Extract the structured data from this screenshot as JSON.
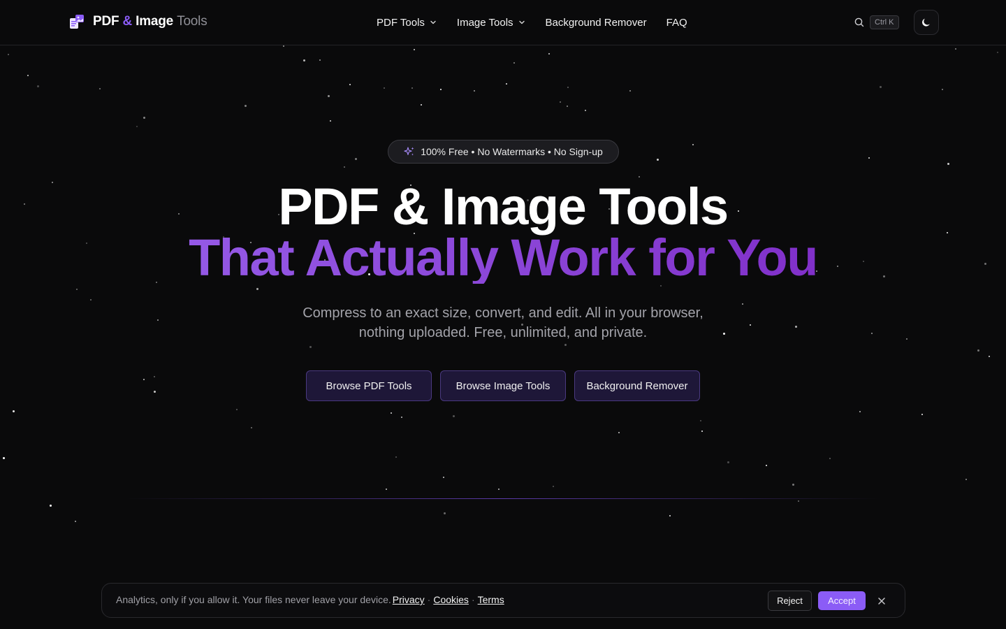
{
  "header": {
    "logo": {
      "part1": "PDF",
      "amp": "&",
      "part2": "Image",
      "part3": "Tools",
      "icon": "pdf-image-logo-icon"
    },
    "nav": [
      {
        "label": "PDF Tools",
        "has_dropdown": true
      },
      {
        "label": "Image Tools",
        "has_dropdown": true
      },
      {
        "label": "Background Remover",
        "has_dropdown": false
      },
      {
        "label": "FAQ",
        "has_dropdown": false
      }
    ],
    "search": {
      "icon": "search-icon",
      "shortcut": "Ctrl K"
    },
    "theme_toggle": {
      "icon": "moon-icon"
    }
  },
  "hero": {
    "badge": {
      "icon": "sparkles-icon",
      "text": "100% Free • No Watermarks • No Sign-up"
    },
    "title_line1": "PDF & Image Tools",
    "title_line2": "That Actually Work for You",
    "subtitle_line1": "Compress to an exact size, convert, and edit. All in your browser,",
    "subtitle_line2": "nothing uploaded. Free, unlimited, and private.",
    "buttons": [
      {
        "label": "Browse PDF Tools"
      },
      {
        "label": "Browse Image Tools"
      },
      {
        "label": "Background Remover"
      }
    ]
  },
  "cookie_bar": {
    "text": "Analytics, only if you allow it. Your files never leave your device.",
    "links": [
      "Privacy",
      "Cookies",
      "Terms"
    ],
    "separator": "·",
    "reject_label": "Reject",
    "accept_label": "Accept",
    "close_icon": "close-icon"
  },
  "colors": {
    "background": "#0a0a0b",
    "accent": "#8b5cf6",
    "gradient_start": "#9a64ee",
    "gradient_end": "#7a22c0",
    "button_bg": "#1e1738",
    "button_border": "#4a3980"
  }
}
